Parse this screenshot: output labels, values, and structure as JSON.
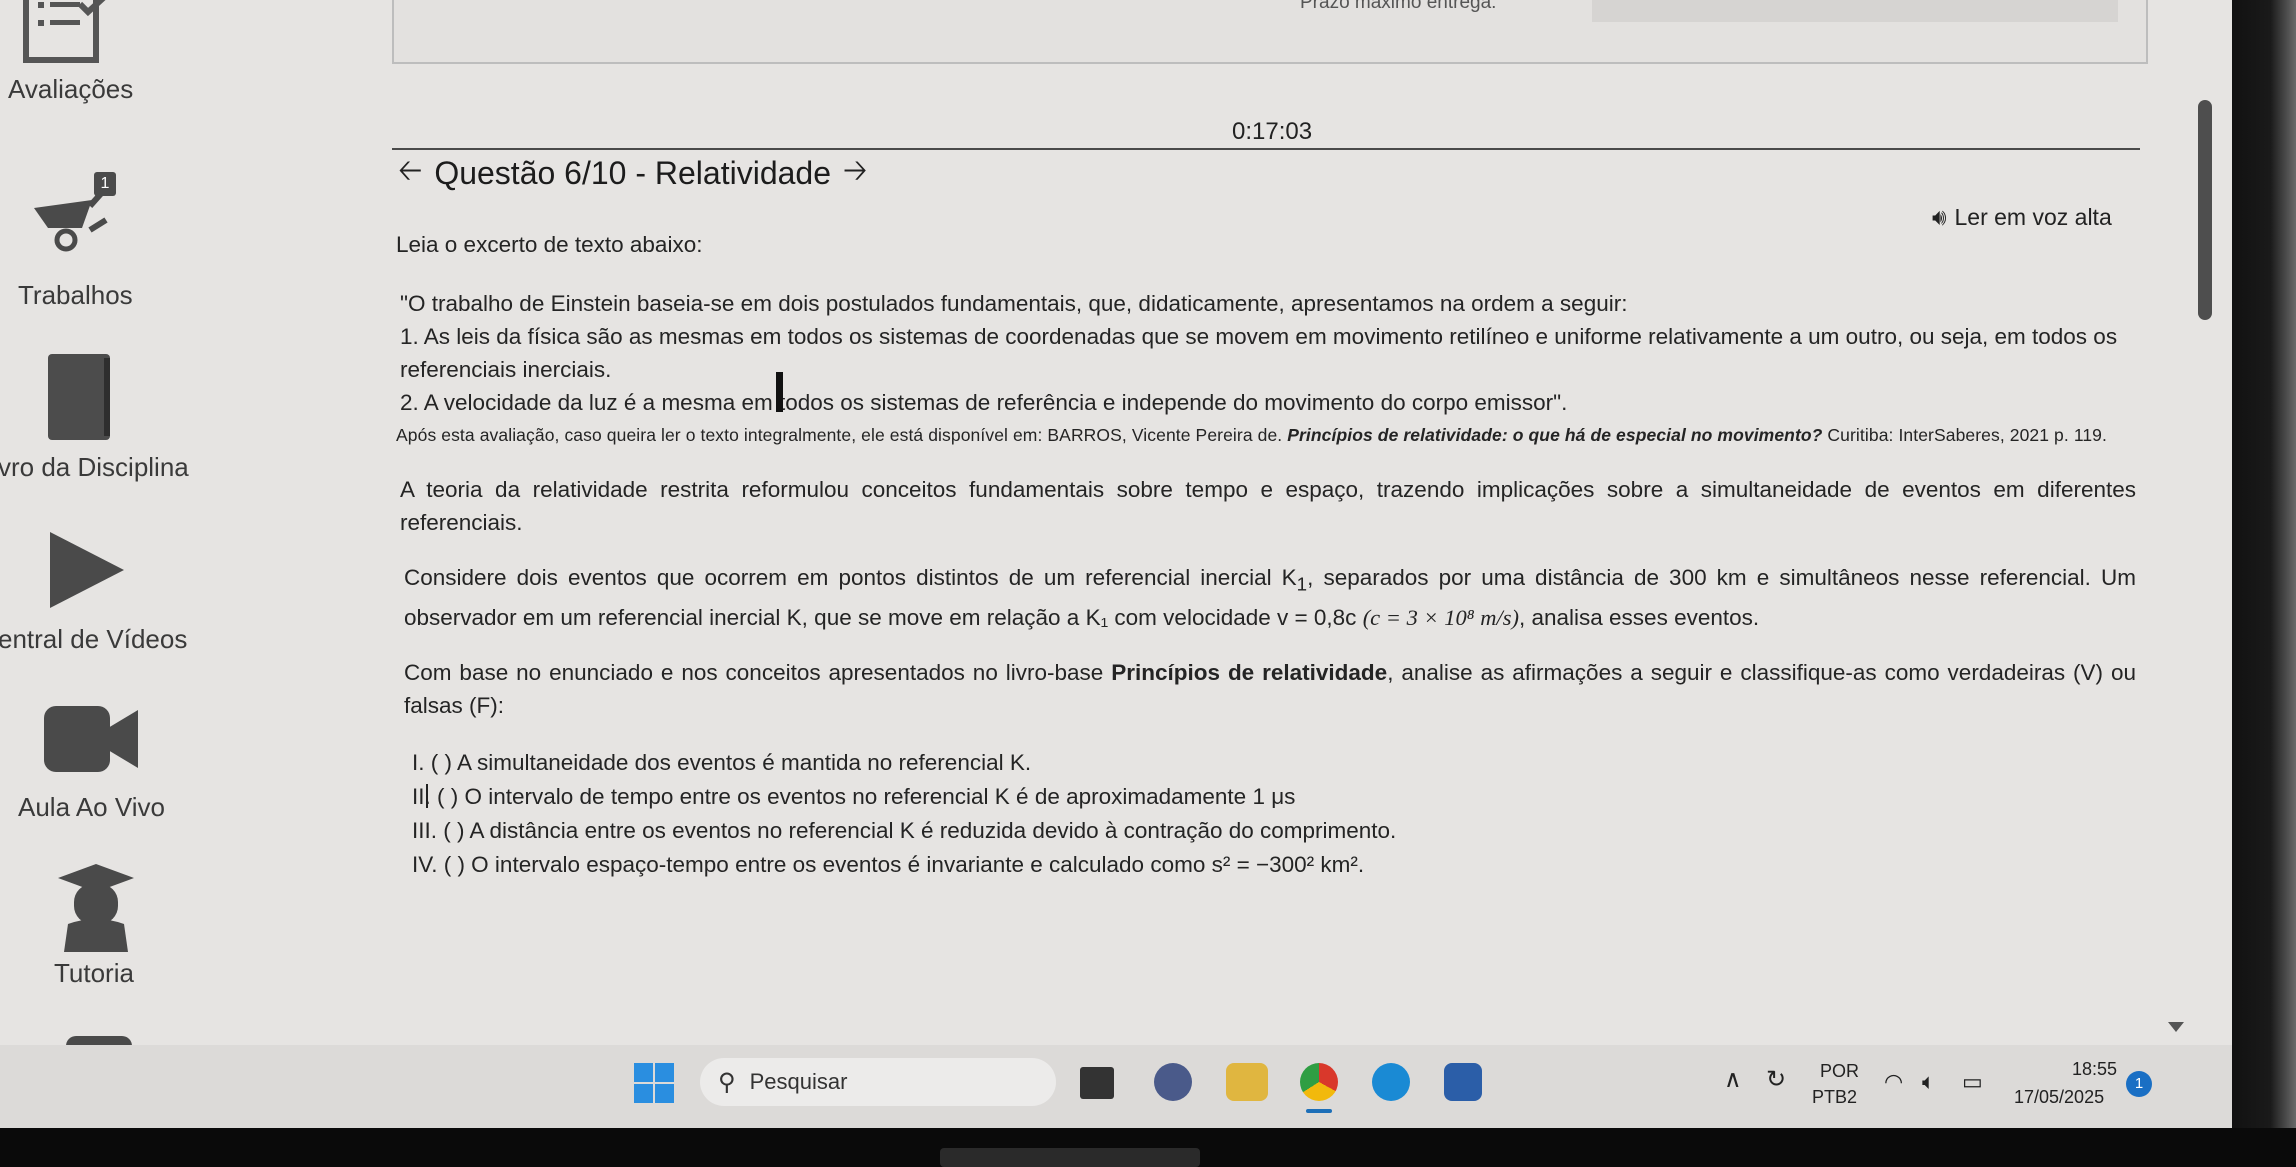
{
  "sidebar": {
    "items": [
      {
        "label": "Avaliações",
        "icon": "checklist-icon"
      },
      {
        "label": "Trabalhos",
        "icon": "wheelbarrow-icon",
        "badge": "1"
      },
      {
        "label": "vro da Disciplina",
        "icon": "book-icon"
      },
      {
        "label": "entral de Vídeos",
        "icon": "play-icon"
      },
      {
        "label": "Aula Ao Vivo",
        "icon": "video-camera-icon"
      },
      {
        "label": "Tutoria",
        "icon": "graduate-icon"
      }
    ]
  },
  "header": {
    "prazo_label": "Prazo máximo entrega:",
    "timer": "0:17:03",
    "question_title": "Questão 6/10 - Relatividade",
    "read_aloud": "Ler em voz alta"
  },
  "question": {
    "intro": "Leia o excerto de texto abaixo:",
    "quote_line1": "\"O trabalho de Einstein baseia-se em dois postulados fundamentais, que, didaticamente, apresentamos na ordem a seguir:",
    "quote_item1": "1. As leis da física são as mesmas em todos os sistemas de coordenadas que se movem em movimento retilíneo e uniforme relativamente a um outro, ou seja, em todos os referenciais inerciais.",
    "quote_item2": "2. A velocidade da luz é a mesma em todos os sistemas de referência e independe do movimento do corpo emissor\".",
    "source_prefix": "Após esta avaliação, caso queira ler o texto integralmente, ele está disponível em: BARROS, Vicente Pereira de.",
    "source_title": "Princípios de relatividade: o que há de especial no movimento?",
    "source_suffix": "Curitiba: InterSaberes, 2021 p. 119.",
    "para1": "A teoria da relatividade restrita reformulou conceitos fundamentais sobre tempo e espaço, trazendo implicações sobre a simultaneidade de eventos em diferentes referenciais.",
    "para2_a": "Considere dois eventos que ocorrem em pontos distintos de um referencial inercial K",
    "para2_sub1": "1",
    "para2_b": ", separados por uma distância de 300 km e simultâneos nesse referencial. Um observador em um referencial inercial K, que se move em relação a K₁ com velocidade v = 0,8c ",
    "para2_formula": "(c = 3 × 10⁸ m/s)",
    "para2_c": ", analisa esses eventos.",
    "para3_a": "Com base no enunciado e nos conceitos apresentados no livro-base ",
    "para3_bold": "Princípios de relatividade",
    "para3_b": ", analise as afirmações a seguir e classifique-as como verdadeiras (V) ou falsas (F):",
    "statements": [
      "I. ( ) A simultaneidade dos eventos é mantida no referencial K.",
      "II. ( ) O intervalo de tempo entre os eventos no referencial K é de aproximadamente 1 μs",
      "III. ( ) A distância entre os eventos no referencial K é reduzida devido à contração do comprimento.",
      "IV. ( ) O intervalo espaço-tempo entre os eventos é invariante e calculado como s² = −300² km²."
    ]
  },
  "taskbar": {
    "search_placeholder": "Pesquisar",
    "lang_top": "POR",
    "lang_bottom": "PTB2",
    "time": "18:55",
    "date": "17/05/2025",
    "notification_count": "1"
  }
}
